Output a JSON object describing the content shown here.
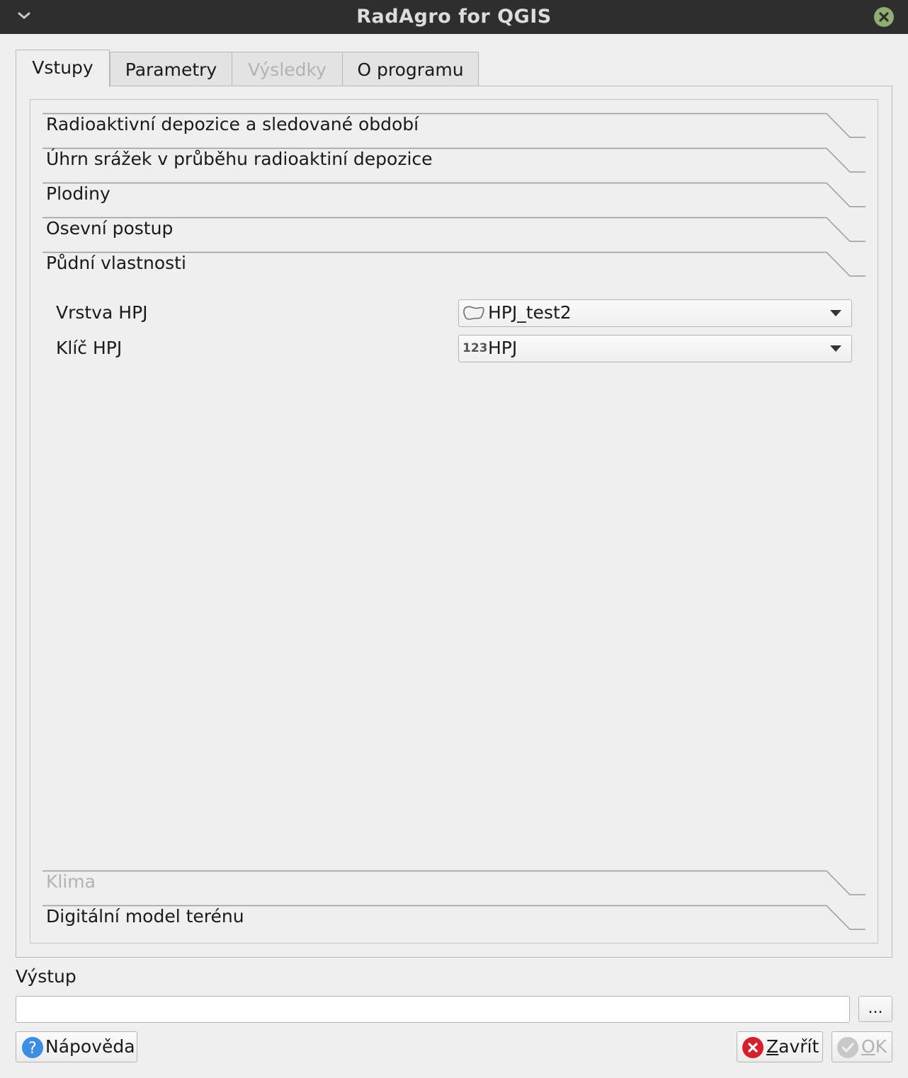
{
  "window": {
    "title": "RadAgro for QGIS"
  },
  "tabs": [
    {
      "label": "Vstupy",
      "state": "active"
    },
    {
      "label": "Parametry",
      "state": "normal"
    },
    {
      "label": "Výsledky",
      "state": "disabled"
    },
    {
      "label": "O programu",
      "state": "normal"
    }
  ],
  "sections": [
    {
      "label": "Radioaktivní depozice a sledované období"
    },
    {
      "label": "Úhrn srážek v průběhu radioaktiní depozice"
    },
    {
      "label": "Plodiny"
    },
    {
      "label": "Osevní postup"
    },
    {
      "label": "Půdní vlastnosti",
      "expanded": true
    },
    {
      "label": "Klima",
      "disabled": true
    },
    {
      "label": "Digitální model terénu"
    }
  ],
  "soil": {
    "layer_label": "Vrstva HPJ",
    "layer_value": "HPJ_test2",
    "key_label": "Klíč HPJ",
    "key_type_icon": "123",
    "key_value": "HPJ"
  },
  "output": {
    "label": "Výstup",
    "value": "",
    "browse_label": "..."
  },
  "buttons": {
    "help": "Nápověda",
    "close_mnemonic": "Z",
    "close_rest": "avřít",
    "ok_mnemonic": "O",
    "ok_rest": "K"
  },
  "colors": {
    "titlebar": "#2e2e2e",
    "close_icon": "#8fae6f",
    "help_icon": "#3d8ee0",
    "cancel_icon": "#d6202c"
  }
}
